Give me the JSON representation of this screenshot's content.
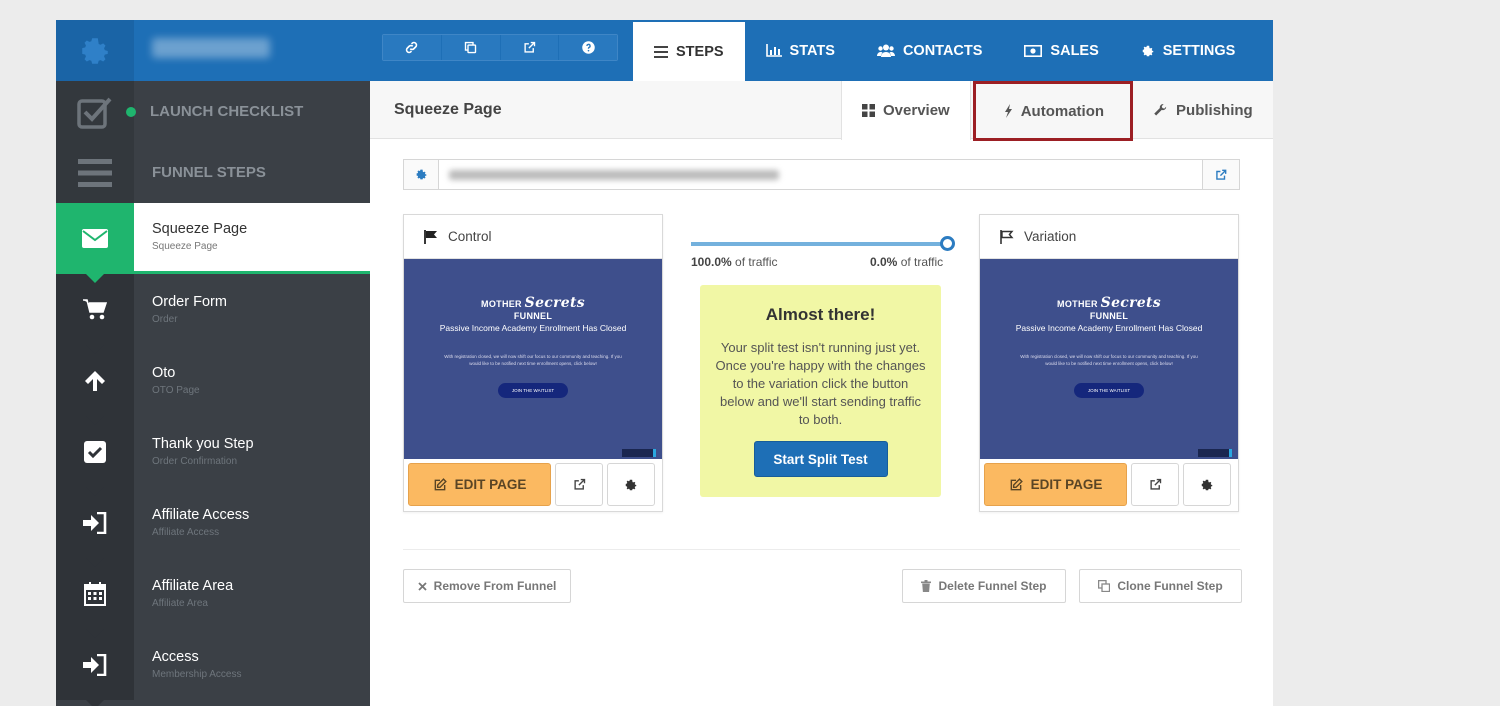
{
  "topbar": {
    "quick_tools": [
      "link-icon",
      "copy-icon",
      "external-link-icon",
      "help-icon"
    ],
    "nav": [
      {
        "label": "STEPS",
        "icon": "bars-icon",
        "active": true
      },
      {
        "label": "STATS",
        "icon": "bar-chart-icon"
      },
      {
        "label": "CONTACTS",
        "icon": "users-icon"
      },
      {
        "label": "SALES",
        "icon": "money-icon"
      },
      {
        "label": "SETTINGS",
        "icon": "gear-icon"
      }
    ]
  },
  "sidebar": {
    "launch_checklist": "LAUNCH CHECKLIST",
    "funnel_steps": "FUNNEL STEPS",
    "items": [
      {
        "title": "Squeeze Page",
        "subtitle": "Squeeze Page",
        "icon": "envelope-icon",
        "active": true
      },
      {
        "title": "Order Form",
        "subtitle": "Order",
        "icon": "cart-icon"
      },
      {
        "title": "Oto",
        "subtitle": "OTO Page",
        "icon": "arrow-up-icon"
      },
      {
        "title": "Thank you Step",
        "subtitle": "Order Confirmation",
        "icon": "checkbox-icon"
      },
      {
        "title": "Affiliate Access",
        "subtitle": "Affiliate Access",
        "icon": "sign-in-icon"
      },
      {
        "title": "Affiliate Area",
        "subtitle": "Affiliate Area",
        "icon": "calendar-icon"
      },
      {
        "title": "Access",
        "subtitle": "Membership Access",
        "icon": "sign-in-icon"
      }
    ]
  },
  "main": {
    "page_title": "Squeeze Page",
    "tabs": [
      {
        "label": "Overview",
        "icon": "grid-icon"
      },
      {
        "label": "Automation",
        "icon": "bolt-icon"
      },
      {
        "label": "Publishing",
        "icon": "wrench-icon"
      }
    ]
  },
  "control": {
    "label": "Control",
    "edit_label": "EDIT PAGE"
  },
  "variation": {
    "label": "Variation",
    "edit_label": "EDIT PAGE"
  },
  "preview": {
    "logo_top": "MOTHER",
    "logo_bottom": "FUNNEL",
    "logo_script": "Secrets",
    "headline": "Passive Income Academy Enrollment Has Closed",
    "body": "With registration closed, we will now shift our focus to our community and teaching. If you would like to be notified next time enrollment opens, click below!",
    "button": "JOIN THE WAITLIST"
  },
  "traffic": {
    "control_value": "100.0%",
    "variation_value": "0.0%",
    "suffix": "of traffic",
    "control_share": 1.0
  },
  "split_note": {
    "title": "Almost there!",
    "body": "Your split test isn't running just yet. Once you're happy with the changes to the variation click the button below and we'll start sending traffic to both.",
    "button": "Start Split Test"
  },
  "footer": {
    "remove": "Remove From Funnel",
    "delete": "Delete Funnel Step",
    "clone": "Clone Funnel Step"
  },
  "colors": {
    "brand_blue": "#1e6fb6",
    "sidebar_dark": "#3b4046",
    "active_green": "#1fb56e",
    "edit_orange": "#fbb961",
    "highlight_red": "#9c1f24",
    "note_yellow": "#f1f7a5"
  }
}
